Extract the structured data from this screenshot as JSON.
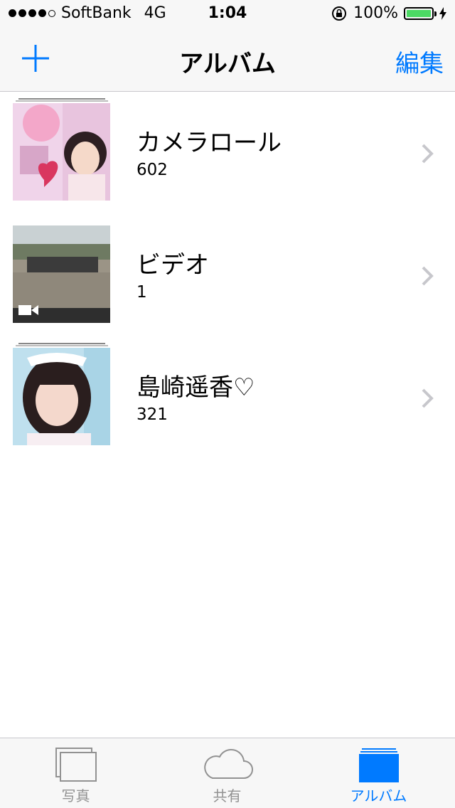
{
  "status_bar": {
    "carrier": "SoftBank",
    "network": "4G",
    "time": "1:04",
    "battery": "100%",
    "signal_bars": 4
  },
  "nav": {
    "title": "アルバム",
    "edit_label": "編集",
    "add_icon": "plus-icon"
  },
  "albums": [
    {
      "name": "カメラロール",
      "count": "602",
      "thumb": "camera-roll-thumbnail"
    },
    {
      "name": "ビデオ",
      "count": "1",
      "thumb": "video-thumbnail"
    },
    {
      "name": "島崎遥香♡",
      "count": "321",
      "thumb": "portrait-album-thumbnail"
    }
  ],
  "tabs": [
    {
      "label": "写真",
      "icon": "photos-icon",
      "active": false
    },
    {
      "label": "共有",
      "icon": "cloud-icon",
      "active": false
    },
    {
      "label": "アルバム",
      "icon": "albums-icon",
      "active": true
    }
  ],
  "colors": {
    "accent": "#007aff",
    "battery": "#4cd964",
    "inactive": "#929292"
  }
}
